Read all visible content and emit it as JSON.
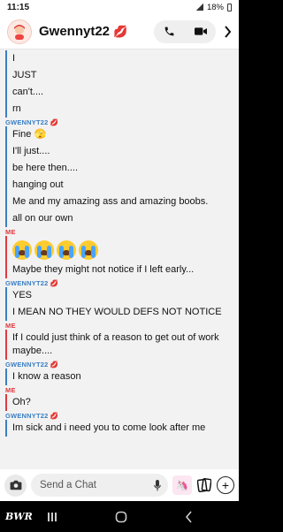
{
  "status": {
    "time": "11:15",
    "battery": "18%"
  },
  "header": {
    "title": "Gwennyt22"
  },
  "messages": [
    {
      "sender": "",
      "who": "g",
      "lines": [
        "I",
        "JUST",
        "can't....",
        "rn"
      ]
    },
    {
      "sender": "GWENNYT22",
      "who": "g",
      "lines": [
        "Fine 🫣",
        "I'll just....",
        "be here then....",
        "hanging out",
        "Me and my amazing ass and amazing boobs.",
        "all on our own"
      ]
    },
    {
      "sender": "ME",
      "who": "me",
      "emoji_count": 4,
      "lines": [
        "Maybe they might not notice if I left early..."
      ]
    },
    {
      "sender": "GWENNYT22",
      "who": "g",
      "lines": [
        "YES",
        "I MEAN NO THEY WOULD DEFS NOT NOTICE"
      ]
    },
    {
      "sender": "ME",
      "who": "me",
      "lines": [
        "If I could just think of a reason to get out of work maybe...."
      ]
    },
    {
      "sender": "GWENNYT22",
      "who": "g",
      "lines": [
        "I know a reason"
      ]
    },
    {
      "sender": "ME",
      "who": "me",
      "lines": [
        "Oh?"
      ]
    },
    {
      "sender": "GWENNYT22",
      "who": "g",
      "lines": [
        "Im sick and i need you to come look after me"
      ]
    }
  ],
  "composer": {
    "placeholder": "Send a Chat"
  },
  "watermark": "BWR",
  "colors": {
    "friend": "#3b7fc4",
    "me": "#e0393e"
  }
}
